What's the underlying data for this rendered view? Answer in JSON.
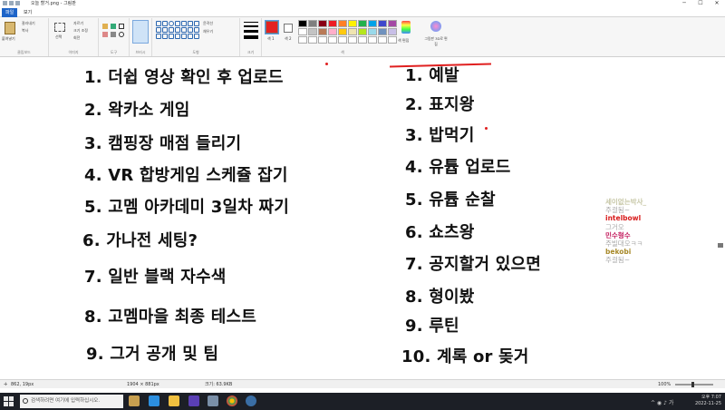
{
  "window": {
    "title": "오늘 할거.png - 그림판",
    "controls": [
      "─",
      "☐",
      "✕"
    ]
  },
  "tabs": {
    "file": "파일",
    "view": "보기"
  },
  "ribbon": {
    "clipboard": {
      "paste": "붙여넣기",
      "cut": "잘라내기",
      "copy": "복사",
      "label": "클립보드"
    },
    "image": {
      "select": "선택",
      "crop": "자르기",
      "resize": "크기 조정",
      "rotate": "회전",
      "label": "이미지"
    },
    "tools": {
      "label": "도구"
    },
    "brushes": {
      "label": "브러시"
    },
    "shapes": {
      "outline": "윤곽선",
      "fill": "채우기",
      "label": "도형"
    },
    "size": {
      "label": "크기"
    },
    "colors": {
      "color1": "색 1",
      "color2": "색 2",
      "edit": "색 편집",
      "paint3d": "그림판 3D로 편집",
      "label": "색"
    },
    "palette": [
      "#000000",
      "#7f7f7f",
      "#880015",
      "#ed1c24",
      "#ff7f27",
      "#fff200",
      "#22b14c",
      "#00a2e8",
      "#3f48cc",
      "#a349a4",
      "#ffffff",
      "#c3c3c3",
      "#b97a57",
      "#ffaec9",
      "#ffc90e",
      "#efe4b0",
      "#b5e61d",
      "#99d9ea",
      "#7092be",
      "#c8bfe7",
      "#ffffff",
      "#ffffff",
      "#ffffff",
      "#ffffff",
      "#ffffff",
      "#ffffff",
      "#ffffff",
      "#ffffff",
      "#ffffff",
      "#ffffff"
    ]
  },
  "canvas": {
    "left_list": [
      "1. 더쉽 영상 확인 후 업로드",
      "2. 왁카소 게임",
      "3. 캠핑장 매점 들리기",
      "4. VR 합방게임 스케쥴 잡기",
      "5. 고멤 아카데미 3일차 짜기",
      "6. 가나전 세팅?",
      "7. 일반 블랙 자수색",
      "8. 고멤마을 최종 테스트",
      "9. 그거 공개 및 팀"
    ],
    "right_list": [
      "1. 예발",
      "2. 표지왕",
      "3. 밥먹기",
      "4. 유튭 업로드",
      "5. 유튭 순찰",
      "6. 쇼츠왕",
      "7. 공지할거 있으면",
      "8. 형이봤",
      "9. 루틴",
      "10. 계록 or 돚거"
    ]
  },
  "chat": [
    {
      "name": "세이없는박사_",
      "msg": "주걸됨~",
      "color": "#c8c8a8"
    },
    {
      "name": "intelbowl",
      "msg": "그거오",
      "color": "#d81b1b"
    },
    {
      "name": "민수형수",
      "msg": "주빌대오ㅋㅋ",
      "color": "#c2185b"
    },
    {
      "name": "bekobi",
      "msg": "주걸됨~",
      "color": "#a88a2a"
    }
  ],
  "status": {
    "cursor": "862, 19px",
    "selection": "",
    "dims": "1904 × 881px",
    "size": "크기: 63.9KB",
    "zoom": "100%"
  },
  "taskbar": {
    "search_placeholder": "검색하려면 여기에 입력하십시오.",
    "time": "오후 7:07",
    "date": "2022-11-25"
  }
}
